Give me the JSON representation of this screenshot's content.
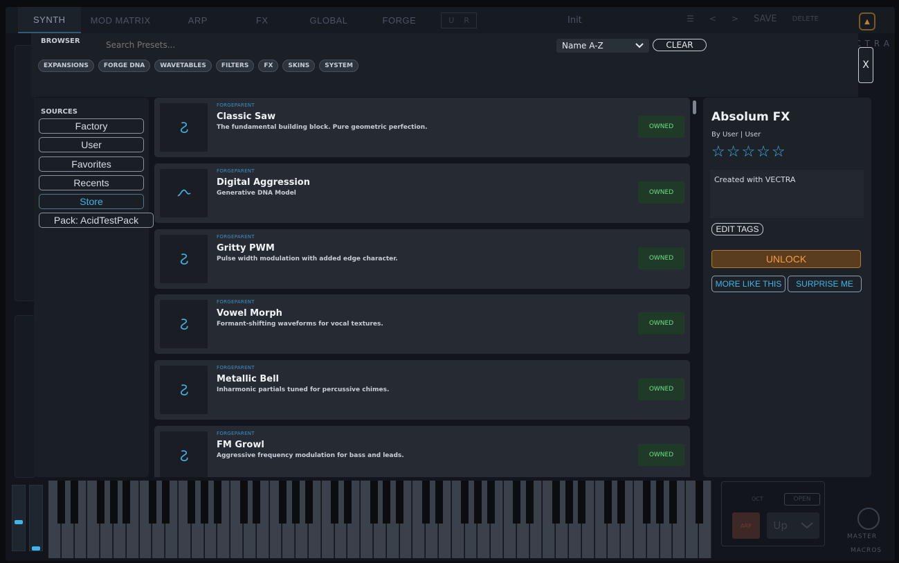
{
  "topbar": {
    "tabs": [
      {
        "label": "SYNTH",
        "active": true
      },
      {
        "label": "MOD MATRIX"
      },
      {
        "label": "ARP"
      },
      {
        "label": "FX"
      },
      {
        "label": "GLOBAL"
      },
      {
        "label": "FORGE"
      }
    ],
    "u_label": "U",
    "r_label": "R",
    "preset_name": "Init",
    "menu_glyph": "☰",
    "prev_glyph": "<",
    "next_glyph": ">",
    "save_label": "SAVE",
    "delete_label": "DELETE",
    "brand_partial": "CTRA"
  },
  "browser": {
    "label": "BROWSER",
    "search_placeholder": "Search Presets...",
    "sort_value": "Name A-Z",
    "clear_label": "CLEAR",
    "close_label": "X",
    "chips": [
      "EXPANSIONS",
      "FORGE DNA",
      "WAVETABLES",
      "FILTERS",
      "FX",
      "SKINS",
      "SYSTEM"
    ]
  },
  "sources": {
    "title": "SOURCES",
    "items": [
      {
        "label": "Factory"
      },
      {
        "label": "User"
      },
      {
        "label": "Favorites"
      },
      {
        "label": "Recents"
      },
      {
        "label": "Store",
        "active": true
      },
      {
        "label": "Pack: AcidTestPack"
      }
    ]
  },
  "presets": [
    {
      "type": "FORGEPARENT",
      "name": "Classic Saw",
      "desc": "The fundamental building block. Pure geometric perfection.",
      "status": "OWNED",
      "icon": "swirl-icon"
    },
    {
      "type": "FORGEPARENT",
      "name": "Digital Aggression",
      "desc": "Generative DNA Model",
      "status": "OWNED",
      "icon": "sine-wave-icon"
    },
    {
      "type": "FORGEPARENT",
      "name": "Gritty PWM",
      "desc": "Pulse width modulation with added edge character.",
      "status": "OWNED",
      "icon": "swirl-icon"
    },
    {
      "type": "FORGEPARENT",
      "name": "Vowel Morph",
      "desc": "Formant-shifting waveforms for vocal textures.",
      "status": "OWNED",
      "icon": "swirl-icon"
    },
    {
      "type": "FORGEPARENT",
      "name": "Metallic Bell",
      "desc": "Inharmonic partials tuned for percussive chimes.",
      "status": "OWNED",
      "icon": "swirl-icon"
    },
    {
      "type": "FORGEPARENT",
      "name": "FM Growl",
      "desc": "Aggressive frequency modulation for bass and leads.",
      "status": "OWNED",
      "icon": "swirl-icon"
    }
  ],
  "detail": {
    "title": "Absolum FX",
    "by": "By User  |  User",
    "stars": "☆☆☆☆☆",
    "description": "Created with VECTRA",
    "edit_tags": "EDIT TAGS",
    "unlock": "UNLOCK",
    "more_like_this": "MORE LIKE THIS",
    "surprise_me": "SURPRISE ME"
  },
  "bottom": {
    "oct_label": "OCT",
    "open_label": "OPEN",
    "arp_label": "ARP",
    "direction": "Up",
    "master_label": "MASTER",
    "macros_label": "MACROS"
  },
  "colors": {
    "accent": "#3fb5e8",
    "owned_green": "#6fe08a",
    "unlock_orange": "#ff9c3a"
  }
}
